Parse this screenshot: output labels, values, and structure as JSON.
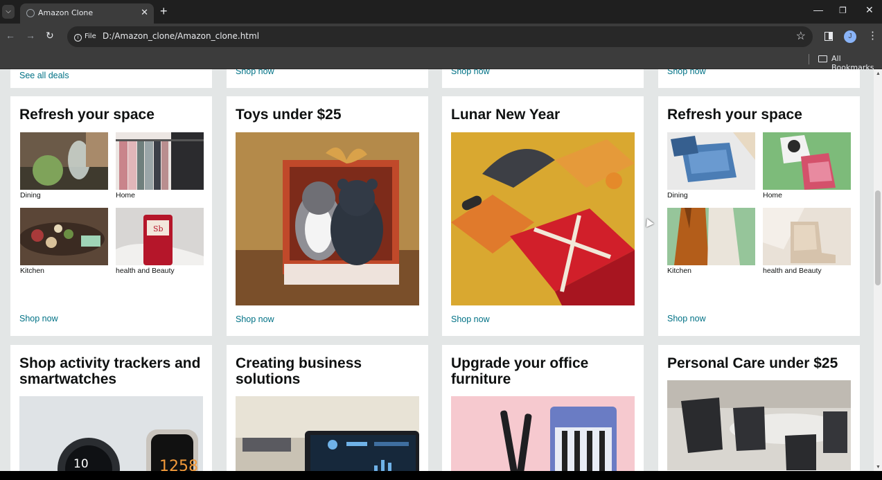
{
  "browser": {
    "tab_title": "Amazon Clone",
    "file_chip": "File",
    "url": "D:/Amazon_clone/Amazon_clone.html",
    "avatar_letter": "J",
    "bookmarks_label": "All Bookmarks"
  },
  "top_row": {
    "col1_link": "See all deals",
    "col2_link": "Shop now",
    "col3_link": "Shop now",
    "col4_link": "Shop now"
  },
  "cards": {
    "refresh1": {
      "title": "Refresh your space",
      "items": [
        "Dining",
        "Home",
        "Kitchen",
        "health and Beauty"
      ],
      "link": "Shop now"
    },
    "toys": {
      "title": "Toys under $25",
      "link": "Shop now"
    },
    "lunar": {
      "title": "Lunar New Year",
      "link": "Shop now"
    },
    "refresh2": {
      "title": "Refresh your space",
      "items": [
        "Dining",
        "Home",
        "Kitchen",
        "health and Beauty"
      ],
      "link": "Shop now"
    },
    "trackers": {
      "title": "Shop activity trackers and smartwatches"
    },
    "business": {
      "title": "Creating business solutions"
    },
    "office": {
      "title": "Upgrade your office furniture"
    },
    "personal": {
      "title": "Personal Care under $25"
    }
  },
  "colors": {
    "link": "#007185",
    "page_bg": "#e3e6e6",
    "card_bg": "#ffffff"
  }
}
